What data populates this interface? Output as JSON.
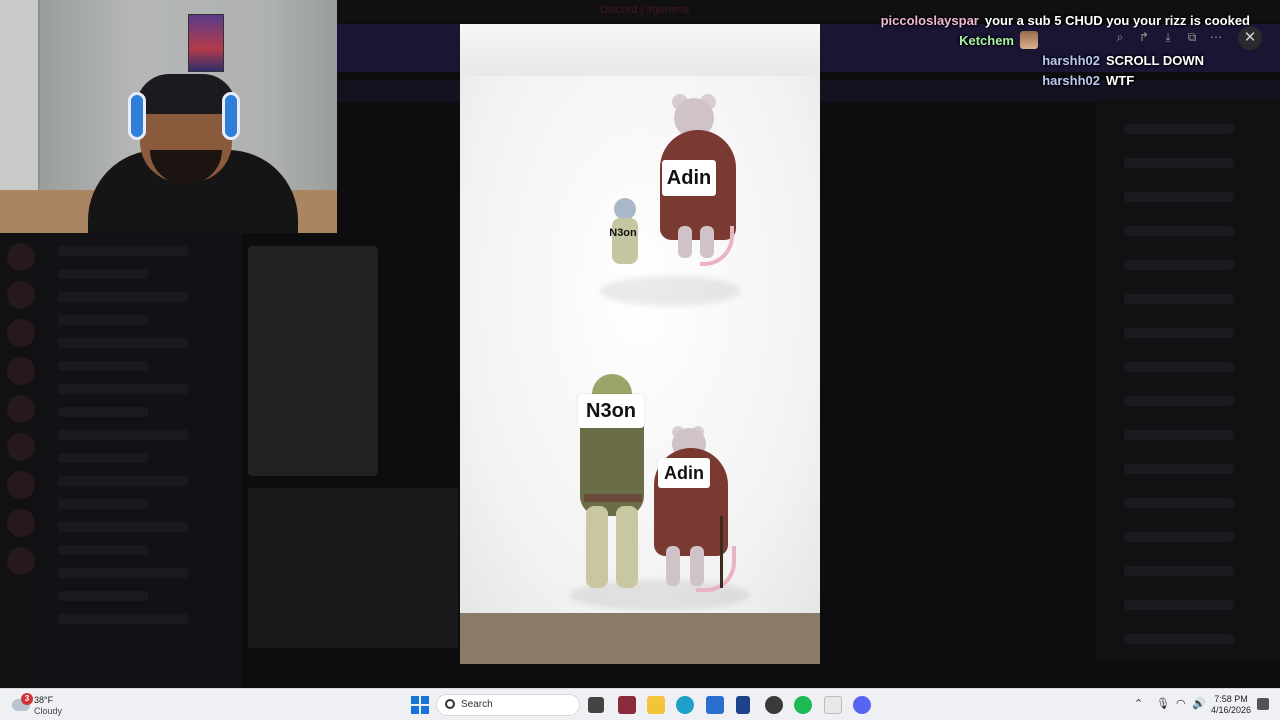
{
  "window": {
    "title": "Discord | #general"
  },
  "chat": [
    {
      "user": "piccoloslayspar",
      "user_color": "#f0b8d8",
      "message": "your a sub 5 CHUD you your rizz is cooked"
    },
    {
      "user": "Ketchem",
      "user_color": "#a8f0a0",
      "message": "",
      "emote": "emote"
    },
    {
      "user": "harshh02",
      "user_color": "#b8c8f0",
      "message": "SCROLL DOWN"
    },
    {
      "user": "harshh02",
      "user_color": "#b8c8f0",
      "message": "WTF"
    }
  ],
  "meme": {
    "top": {
      "big_label": "Adin",
      "small_label": "N3on"
    },
    "bottom": {
      "big_label": "N3on",
      "small_label": "Adin"
    }
  },
  "viewer_controls": {
    "zoom_icon": "zoom-icon",
    "forward_icon": "forward-icon",
    "download_icon": "download-icon",
    "open_icon": "open-external-icon",
    "more_icon": "more-icon",
    "close_icon": "close-icon",
    "zoom_glyph": "⌕",
    "forward_glyph": "↱",
    "download_glyph": "⤓",
    "open_glyph": "⧉",
    "more_glyph": "⋯",
    "close_glyph": "✕"
  },
  "taskbar": {
    "weather": {
      "badge": "3",
      "temp": "38°F",
      "condition": "Cloudy"
    },
    "search_placeholder": "Search",
    "clock": {
      "time": "7:58 PM",
      "date": "4/16/2026"
    },
    "pinned": [
      {
        "name": "file-explorer-icon",
        "color": "#f3c33a"
      },
      {
        "name": "edge-icon",
        "color": "#1fa0c8"
      },
      {
        "name": "store-icon",
        "color": "#2a6fd0"
      },
      {
        "name": "nba-icon",
        "color": "#1d428a"
      },
      {
        "name": "obs-icon",
        "color": "#3a3a3a"
      },
      {
        "name": "spotify-icon",
        "color": "#1db954"
      },
      {
        "name": "notepad-icon",
        "color": "#e8e8e8"
      },
      {
        "name": "discord-icon",
        "color": "#5865f2"
      }
    ]
  }
}
